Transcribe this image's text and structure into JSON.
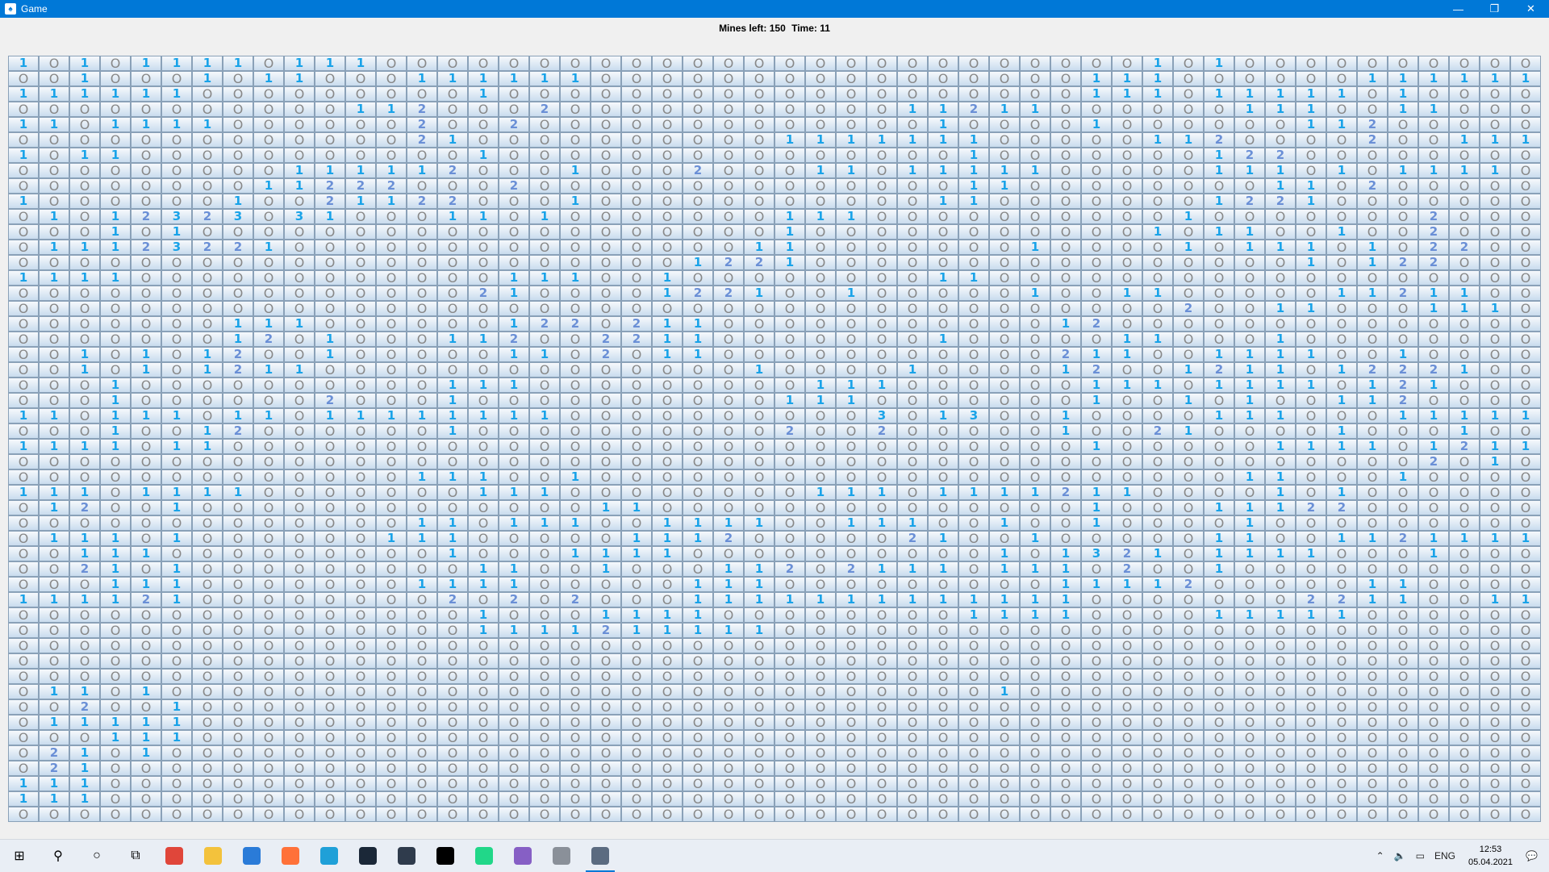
{
  "window": {
    "title": "Game"
  },
  "status": {
    "mines_label": "Mines left: 150",
    "time_label": "Time: 11"
  },
  "board": {
    "rows": [
      "10101111011100000000000000000000000001010000000000",
      "00100010110001111110000000000000000111000000111111",
      "11111100000000010000000000000000000111011111010000",
      "00000000000112000200000000000112110000001110011000",
      "11011110000002002000000000000010000100000011200000",
      "00000000000002100000000001111111000001120000200111",
      "10110000000000010000000000000001000000012200000000",
      "00000000011111200010002000110111110000011101011110",
      "00000000112220002000000000000001100000000110200000",
      "10000001002112200010000000000011000000012210000000",
      "01012323031000110100000001110000000000100000002000",
      "00010100000000000000000001000000000001011001002000",
      "01112322100000000000000011000000010000101110102200",
      "00000000000000000000001221000000000000000010122000",
      "11110000000000001110010000000011000000000000000000",
      "00000000000000021000012210010000010011000001121100",
      "00000000000000000000000000000000000000200110001110",
      "00000001110000001220211000000000001200000000000000",
      "00000001201000112002211000000010000011000100000000",
      "00101012001000001102011000000000002110011110010000",
      "00101012110000000000000010000100001200121101222100",
      "00010000000000111000000000111000000111011110121000",
      "00010000002000100000000001110000000100101001120000",
      "11011101101111111100000000003013001000011100011111",
      "00010012000000100000000002002000001002100001000100",
      "11110110000000000000000000000000000100000111101211",
      "00000000000000000000000000000000000000000000002010",
      "00000000000001110010000000000000000000001100010000",
      "11101111000000011100000000111011112110000101000000",
      "01200100000000000001100000000000000100011122000000",
      "00000000000001101110011110011100100100001000000000",
      "01110100000011100000111200000210010000011001121111",
      "00111000000000100011110000000000101321011110001000",
      "00210100000000011001000112021110111020010000000000",
      "00011100000001111000001110000000001111200000110000",
      "11112100000000202020001111111111111000000022110011",
      "00000000000000010001111000000001111000011111000000",
      "00000000000000011112111110000000000000000000000000",
      "00000000000000000000000000000000000000000000000000",
      "00000000000000000000000000000000000000000000000000",
      "00000000000000000000000000000000000000000000000000",
      "01101000000000000000000000000000100000000000000000",
      "00200100000000000000000000000000000000000000000000",
      "01111100000000000000000000000000000000000000000000",
      "00011100000000000000000000000000000000000000000000",
      "02101000000000000000000000000000000000000000000000",
      "02100000000000000000000000000000000000000000000000",
      "11100000000000000000000000000000000000000000000000",
      "11100000000000000000000000000000000000000000000000",
      "00000000000000000000000000000000000000000000000000"
    ]
  },
  "taskbar": {
    "items": [
      {
        "name": "start-icon",
        "glyph": "⊞",
        "color": "#000"
      },
      {
        "name": "search-icon",
        "glyph": "⚲",
        "color": "#000"
      },
      {
        "name": "cortana-icon",
        "glyph": "○",
        "color": "#000"
      },
      {
        "name": "task-view-icon",
        "glyph": "⧉",
        "color": "#000"
      },
      {
        "name": "chrome-icon",
        "glyph": "",
        "color": "#e0463a"
      },
      {
        "name": "explorer-icon",
        "glyph": "",
        "color": "#f3c23c"
      },
      {
        "name": "mail-icon",
        "glyph": "",
        "color": "#2a7bd8"
      },
      {
        "name": "firefox-icon",
        "glyph": "",
        "color": "#ff7139"
      },
      {
        "name": "edge-icon",
        "glyph": "",
        "color": "#1fa0d8"
      },
      {
        "name": "steam-icon",
        "glyph": "",
        "color": "#1b2838"
      },
      {
        "name": "app-icon",
        "glyph": "",
        "color": "#2f3b4c"
      },
      {
        "name": "intellij-icon",
        "glyph": "",
        "color": "#000"
      },
      {
        "name": "clion-icon",
        "glyph": "",
        "color": "#21d789"
      },
      {
        "name": "visual-studio-icon",
        "glyph": "",
        "color": "#865fc5"
      },
      {
        "name": "tool-icon",
        "glyph": "",
        "color": "#8a9099"
      },
      {
        "name": "game-icon",
        "glyph": "",
        "color": "#5b6b80"
      }
    ],
    "tray": {
      "lang": "ENG",
      "time": "12:53",
      "date": "05.04.2021"
    }
  },
  "colors": {
    "title_bar": "#0078d7",
    "digit_1": "#1aa3e8",
    "digit_2": "#6a8fd6",
    "zero": "#888888"
  }
}
